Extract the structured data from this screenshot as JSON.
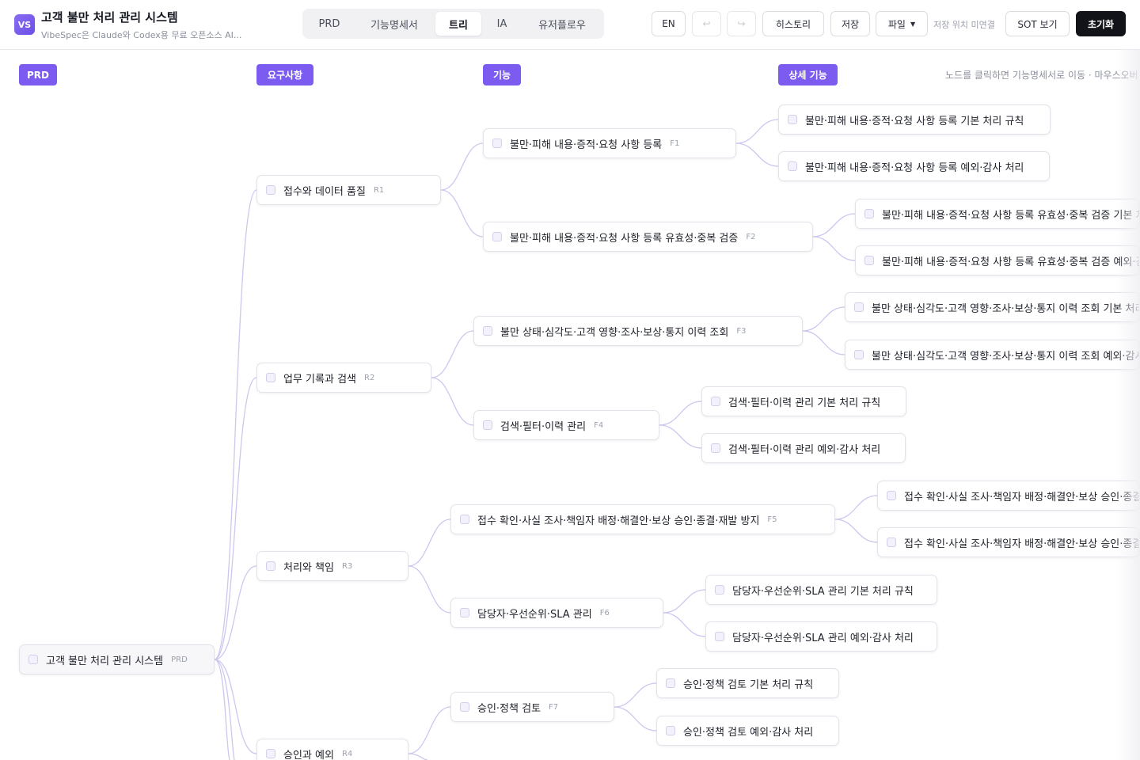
{
  "header": {
    "logo_text": "VS",
    "title": "고객 불만 처리 관리 시스템",
    "subtitle": "VibeSpec은 Claude와 Codex용 무료 오픈소스 AI...",
    "tabs": [
      "PRD",
      "기능명세서",
      "트리",
      "IA",
      "유저플로우"
    ],
    "active_tab": "트리",
    "lang_label": "EN",
    "undo_icon": "undo-icon",
    "redo_icon": "redo-icon",
    "history_label": "히스토리",
    "save_label": "저장",
    "file_label": "파일",
    "save_location": "저장 위치 미연결",
    "sot_label": "SOT 보기",
    "reset_label": "초기화"
  },
  "canvas": {
    "columns": [
      "PRD",
      "요구사항",
      "기능",
      "상세 기능"
    ],
    "hint": "노드를 클릭하면 기능명세서로 이동 · 마우스오버"
  },
  "tree": {
    "root": {
      "label": "고객 불만 처리 관리 시스템",
      "code": "PRD"
    },
    "requirements": [
      {
        "label": "접수와 데이터 품질",
        "code": "R1"
      },
      {
        "label": "업무 기록과 검색",
        "code": "R2"
      },
      {
        "label": "처리와 책임",
        "code": "R3"
      },
      {
        "label": "승인과 예외",
        "code": "R4"
      }
    ],
    "features": [
      {
        "label": "불만·피해 내용·증적·요청 사항 등록",
        "code": "F1"
      },
      {
        "label": "불만·피해 내용·증적·요청 사항 등록 유효성·중복 검증",
        "code": "F2"
      },
      {
        "label": "불만 상태·심각도·고객 영향·조사·보상·통지 이력 조회",
        "code": "F3"
      },
      {
        "label": "검색·필터·이력 관리",
        "code": "F4"
      },
      {
        "label": "접수 확인·사실 조사·책임자 배정·해결안·보상 승인·종결·재발 방지",
        "code": "F5"
      },
      {
        "label": "담당자·우선순위·SLA 관리",
        "code": "F6"
      },
      {
        "label": "승인·정책 검토",
        "code": "F7"
      }
    ],
    "details": [
      "불만·피해 내용·증적·요청 사항 등록 기본 처리 규칙",
      "불만·피해 내용·증적·요청 사항 등록 예외·감사 처리",
      "불만·피해 내용·증적·요청 사항 등록 유효성·중복 검증 기본 처리 규칙",
      "불만·피해 내용·증적·요청 사항 등록 유효성·중복 검증 예외·감사 처리",
      "불만 상태·심각도·고객 영향·조사·보상·통지 이력 조회 기본 처리 규칙",
      "불만 상태·심각도·고객 영향·조사·보상·통지 이력 조회 예외·감사 처리",
      "검색·필터·이력 관리 기본 처리 규칙",
      "검색·필터·이력 관리 예외·감사 처리",
      "접수 확인·사실 조사·책임자 배정·해결안·보상 승인·종결·재발 방지 기본 처리 규칙",
      "접수 확인·사실 조사·책임자 배정·해결안·보상 승인·종결·재발 방지 예외·감사 처리",
      "담당자·우선순위·SLA 관리 기본 처리 규칙",
      "담당자·우선순위·SLA 관리 예외·감사 처리",
      "승인·정책 검토 기본 처리 규칙",
      "승인·정책 검토 예외·감사 처리"
    ]
  },
  "colors": {
    "accent": "#7c5cf0",
    "edge": "#c9c2ec"
  }
}
